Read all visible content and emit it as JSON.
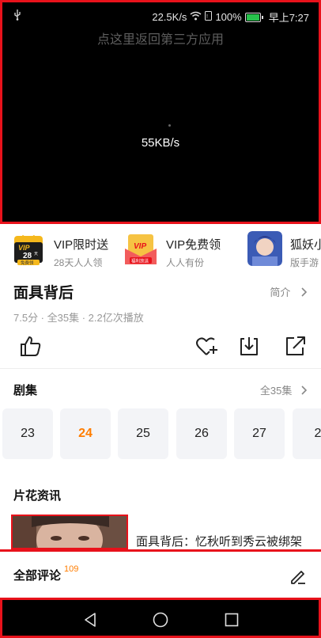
{
  "status": {
    "usb_icon": "usb-icon",
    "speed": "22.5K/s",
    "battery": "100%",
    "time": "早上7:27"
  },
  "player": {
    "back_hint": "点这里返回第三方应用",
    "speed_text": "55KB/s"
  },
  "promos": [
    {
      "title": "VIP限时送",
      "subtitle": "28天人人领",
      "badge_top": "VIP",
      "badge_num": "28",
      "badge_day": "天",
      "badge_bottom": "免费领"
    },
    {
      "title": "VIP免费领",
      "subtitle": "人人有份",
      "badge_top": "VIP",
      "badge_bottom": "福利放送"
    },
    {
      "title": "狐妖小",
      "subtitle": "版手游"
    }
  ],
  "show": {
    "title": "面具背后",
    "intro_label": "简介",
    "meta": "7.5分 · 全35集 · 2.2亿次播放"
  },
  "actions": [
    "like-icon",
    "favorite-add-icon",
    "download-icon",
    "share-icon"
  ],
  "episodes": {
    "header": "剧集",
    "all_label": "全35集",
    "items": [
      "23",
      "24",
      "25",
      "26",
      "27",
      "2"
    ],
    "active_index": 1
  },
  "news": {
    "header": "片花资讯",
    "item_title": "面具背后：忆秋听到秀云被绑架"
  },
  "comments": {
    "header": "全部评论",
    "count": "109"
  },
  "colors": {
    "accent": "#ff7d00",
    "highlight_border": "#e8121b"
  }
}
